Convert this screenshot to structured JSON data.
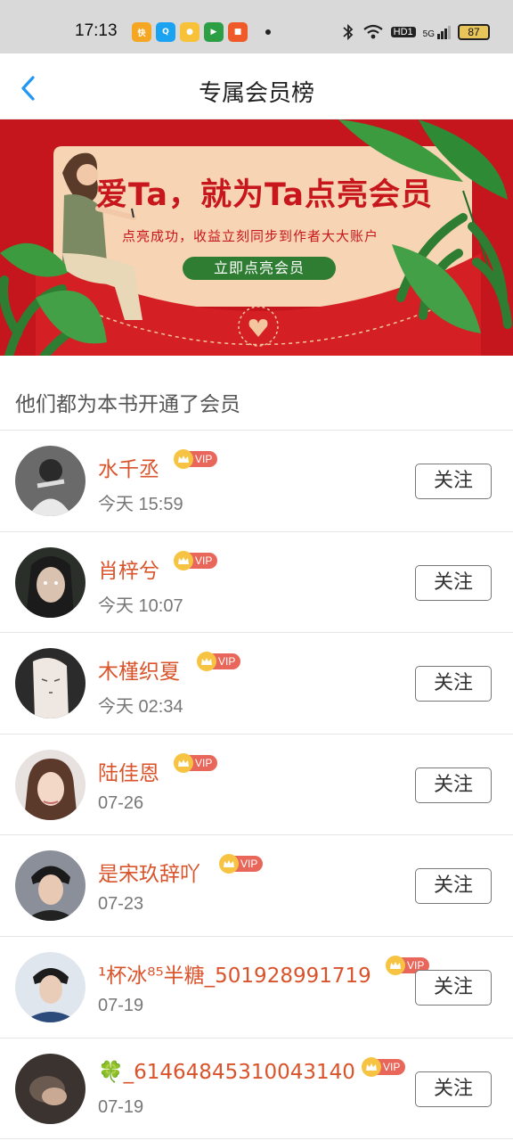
{
  "status_bar": {
    "time": "17:13",
    "battery": "87",
    "network": "5G",
    "hd": "HD1",
    "app_icons": [
      "kuaishou-icon",
      "qq-icon",
      "game-icon",
      "video-icon",
      "app-icon"
    ]
  },
  "header": {
    "title": "专属会员榜",
    "back_icon": "chevron-left-icon"
  },
  "banner": {
    "headline": "爱Ta，就为Ta点亮会员",
    "subtitle": "点亮成功，收益立刻同步到作者大大账户",
    "button_label": "立即点亮会员"
  },
  "section_title": "他们都为本书开通了会员",
  "colors": {
    "accent": "#d9532b",
    "banner_red": "#c4161c",
    "vip_tag": "#e8675a",
    "vip_crown": "#f6c342",
    "back_blue": "#2196f3"
  },
  "members": [
    {
      "name": "水千丞",
      "vip": "VIP",
      "time": "今天 15:59",
      "follow_label": "关注"
    },
    {
      "name": "肖梓兮",
      "vip": "VIP",
      "time": "今天 10:07",
      "follow_label": "关注"
    },
    {
      "name": "木槿织夏",
      "vip": "VIP",
      "time": "今天 02:34",
      "follow_label": "关注"
    },
    {
      "name": "陆佳恩",
      "vip": "VIP",
      "time": "07-26",
      "follow_label": "关注"
    },
    {
      "name": "是宋玖辞吖",
      "vip": "VIP",
      "time": "07-23",
      "follow_label": "关注"
    },
    {
      "name": "¹杯冰⁸⁵半糖_501928991719",
      "vip": "VIP",
      "time": "07-19",
      "follow_label": "关注"
    },
    {
      "name": "🍀_61464845310043140",
      "vip": "VIP",
      "time": "07-19",
      "follow_label": "关注"
    }
  ]
}
